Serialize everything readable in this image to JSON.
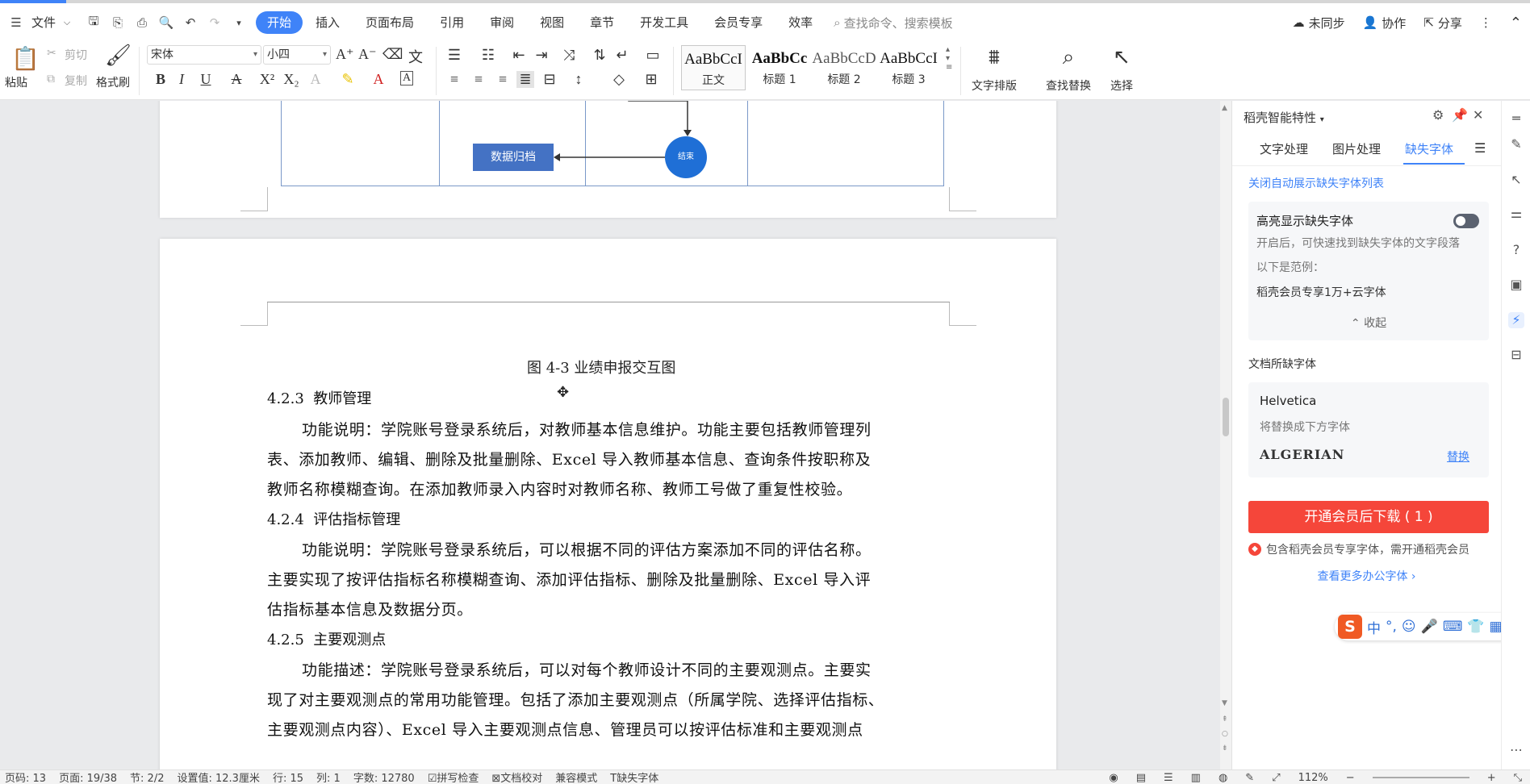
{
  "menubar": {
    "file_label": "文件",
    "tabs": [
      "开始",
      "插入",
      "页面布局",
      "引用",
      "审阅",
      "视图",
      "章节",
      "开发工具",
      "会员专享",
      "效率"
    ],
    "search_placeholder": "查找命令、搜索模板",
    "right": {
      "sync": "未同步",
      "collab": "协作",
      "share": "分享"
    }
  },
  "ribbon": {
    "paste": "粘贴",
    "cut": "剪切",
    "copy": "复制",
    "format_painter": "格式刷",
    "font_name": "宋体",
    "font_size": "小四",
    "styles": [
      {
        "sample": "AaBbCcI",
        "name": "正文"
      },
      {
        "sample": "AaBbCc",
        "name": "标题 1"
      },
      {
        "sample": "AaBbCcD",
        "name": "标题 2"
      },
      {
        "sample": "AaBbCcI",
        "name": "标题 3"
      }
    ],
    "text_layout": "文字排版",
    "find_replace": "查找替换",
    "select": "选择"
  },
  "document": {
    "diagram": {
      "archive_label": "数据归档",
      "end_label": "结束"
    },
    "caption": "图 4-3  业绩申报交互图",
    "blocks": [
      {
        "type": "heading",
        "num": "4.2.3",
        "title": "教师管理"
      },
      {
        "type": "para",
        "lines": [
          "功能说明：学院账号登录系统后，对教师基本信息维护。功能主要包括教师管理列",
          "表、添加教师、编辑、删除及批量删除、Excel 导入教师基本信息、查询条件按职称及",
          "教师名称模糊查询。在添加教师录入内容时对教师名称、教师工号做了重复性校验。"
        ]
      },
      {
        "type": "heading",
        "num": "4.2.4",
        "title": "评估指标管理"
      },
      {
        "type": "para",
        "lines": [
          "功能说明：学院账号登录系统后，可以根据不同的评估方案添加不同的评估名称。",
          "主要实现了按评估指标名称模糊查询、添加评估指标、删除及批量删除、Excel 导入评",
          "估指标基本信息及数据分页。"
        ]
      },
      {
        "type": "heading",
        "num": "4.2.5",
        "title": "主要观测点"
      },
      {
        "type": "para",
        "lines": [
          "功能描述：学院账号登录系统后，可以对每个教师设计不同的主要观测点。主要实",
          "现了对主要观测点的常用功能管理。包括了添加主要观测点（所属学院、选择评估指标、",
          "主要观测点内容）、Excel 导入主要观测点信息、管理员可以按评估标准和主要观测点"
        ]
      }
    ]
  },
  "panel": {
    "title": "稻壳智能特性",
    "tabs": [
      "文字处理",
      "图片处理",
      "缺失字体"
    ],
    "active_tab": "缺失字体",
    "auto_close_link": "关闭自动展示缺失字体列表",
    "highlight": {
      "title": "高亮显示缺失字体",
      "desc": "开启后，可快速找到缺失字体的文字段落",
      "example_label": "以下是范例：",
      "example": "稻壳会员专享1万+云字体",
      "collapse": "收起"
    },
    "missing_section_label": "文档所缺字体",
    "missing_font": {
      "name": "Helvetica",
      "replace_hint": "将替换成下方字体",
      "replacement": "ALGERIAN",
      "replace_link": "替换"
    },
    "download_button": "开通会员后下载 ( 1 )",
    "member_note": "包含稻壳会员专享字体，需开通稻壳会员",
    "more_fonts_link": "查看更多办公字体"
  },
  "ime": {
    "mode": "中"
  },
  "statusbar": {
    "items": [
      "页码: 13",
      "页面: 19/38",
      "节: 2/2",
      "设置值: 12.3厘米",
      "行: 15",
      "列: 1",
      "字数: 12780",
      "拼写检查",
      "文档校对",
      "兼容模式",
      "缺失字体"
    ],
    "zoom": "112%"
  }
}
